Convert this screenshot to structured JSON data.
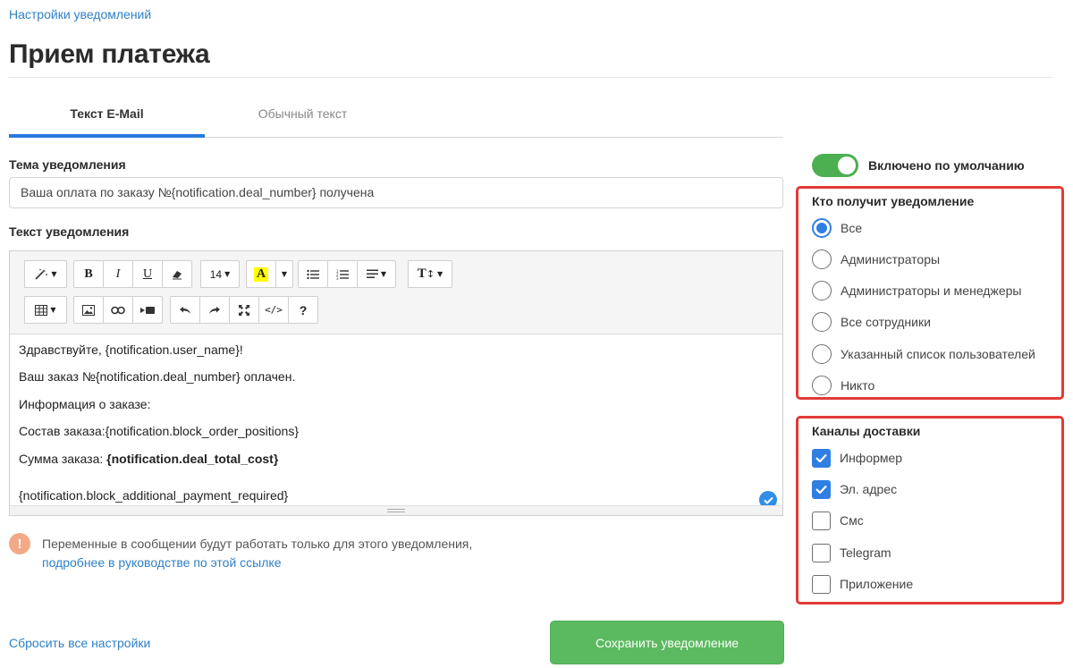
{
  "breadcrumb": "Настройки уведомлений",
  "page_title": "Прием платежа",
  "tabs": [
    {
      "label": "Текст E-Mail",
      "active": true
    },
    {
      "label": "Обычный текст",
      "active": false
    }
  ],
  "subject": {
    "label": "Тема уведомления",
    "value": "Ваша оплата по заказу №{notification.deal_number} получена"
  },
  "body": {
    "label": "Текст уведомления",
    "toolbar": {
      "font_size": "14",
      "highlight_letter": "A",
      "icons": [
        "magic-wand",
        "bold",
        "italic",
        "underline",
        "eraser",
        "font-size",
        "highlight",
        "unordered-list",
        "ordered-list",
        "align",
        "text-height",
        "table",
        "image",
        "link",
        "video",
        "undo",
        "redo",
        "fullscreen",
        "code",
        "help"
      ]
    },
    "lines": {
      "greeting": "Здравствуйте, {notification.user_name}!",
      "order_paid": "Ваш заказ №{notification.deal_number} оплачен.",
      "info": "Информация о заказе:",
      "composition": "Состав заказа:{notification.block_order_positions}",
      "sum_label": "Сумма заказа: ",
      "sum_value": "{notification.deal_total_cost}",
      "additional": "{notification.block_additional_payment_required}"
    }
  },
  "notice": {
    "text": "Переменные в сообщении будут работать только для этого уведомления,",
    "link": "подробнее в руководстве по этой ссылке"
  },
  "reset_link": "Сбросить все настройки",
  "save_button": "Сохранить уведомление",
  "toggle": {
    "label": "Включено по умолчанию",
    "enabled": true
  },
  "recipients": {
    "title": "Кто получит уведомление",
    "options": [
      {
        "label": "Все",
        "selected": true
      },
      {
        "label": "Администраторы",
        "selected": false
      },
      {
        "label": "Администраторы и менеджеры",
        "selected": false
      },
      {
        "label": "Все сотрудники",
        "selected": false
      },
      {
        "label": "Указанный список пользователей",
        "selected": false
      },
      {
        "label": "Никто",
        "selected": false
      }
    ]
  },
  "channels": {
    "title": "Каналы доставки",
    "options": [
      {
        "label": "Информер",
        "checked": true
      },
      {
        "label": "Эл. адрес",
        "checked": true
      },
      {
        "label": "Смс",
        "checked": false
      },
      {
        "label": "Telegram",
        "checked": false
      },
      {
        "label": "Приложение",
        "checked": false
      }
    ]
  },
  "colors": {
    "link": "#2f80c6",
    "tab_accent": "#2979e0",
    "save_button": "#5bba5f",
    "toggle_on": "#4caf50",
    "panel_border": "#e23a36",
    "control_accent": "#2f7fe3",
    "notice_icon": "#f2a987"
  }
}
